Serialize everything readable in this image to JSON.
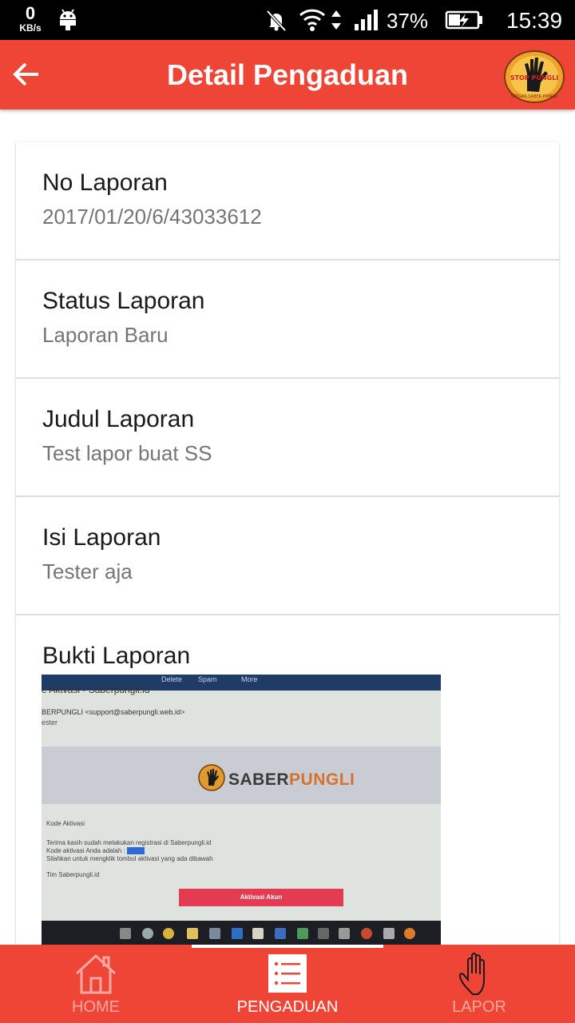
{
  "status_bar": {
    "net_speed_value": "0",
    "net_speed_unit": "KB/s",
    "battery": "37%",
    "time": "15:39",
    "icons": [
      "android-icon",
      "mute-icon",
      "wifi-icon",
      "data-arrows-icon",
      "signal-icon",
      "battery-charging-icon"
    ]
  },
  "app_bar": {
    "title": "Detail Pengaduan",
    "back_icon": "arrow-left-icon",
    "logo": "stop-pungli-logo"
  },
  "details": [
    {
      "label": "No Laporan",
      "value": "2017/01/20/6/43033612"
    },
    {
      "label": "Status Laporan",
      "value": "Laporan Baru"
    },
    {
      "label": "Judul Laporan",
      "value": "Test lapor buat SS"
    },
    {
      "label": "Isi Laporan",
      "value": "Tester aja"
    }
  ],
  "evidence": {
    "label": "Bukti Laporan",
    "photo": {
      "top_actions": [
        "Delete",
        "Spam",
        "More"
      ],
      "tab_title": "e Aktvasi - Saberpungli.id",
      "sender": "BERPUNGLI <support@saberpungli.web.id>",
      "recipient": "ester",
      "brand_part1": "SABER",
      "brand_part2": "PUNGLI",
      "line1": "Kode Aktivasi",
      "line2": "Terima kasih sudah melakukan registrasi di Saberpungli.id",
      "line3": "Kode aktivasi Anda adalah :",
      "line4": "Silahkan untuk mengklik tombol aktivasi yang ada dibawah",
      "line5": "Tim Saberpungli.id",
      "button": "Aktivasi Akun"
    }
  },
  "bottom_nav": [
    {
      "label": "HOME",
      "icon": "home-icon",
      "active": false
    },
    {
      "label": "PENGADUAN",
      "icon": "list-icon",
      "active": true
    },
    {
      "label": "LAPOR",
      "icon": "hand-icon",
      "active": false
    }
  ],
  "colors": {
    "primary": "#ef4537",
    "status_bar": "#000000",
    "label_text": "#1a1a1a",
    "value_text": "#757575",
    "nav_inactive": "#f7a8a0"
  }
}
